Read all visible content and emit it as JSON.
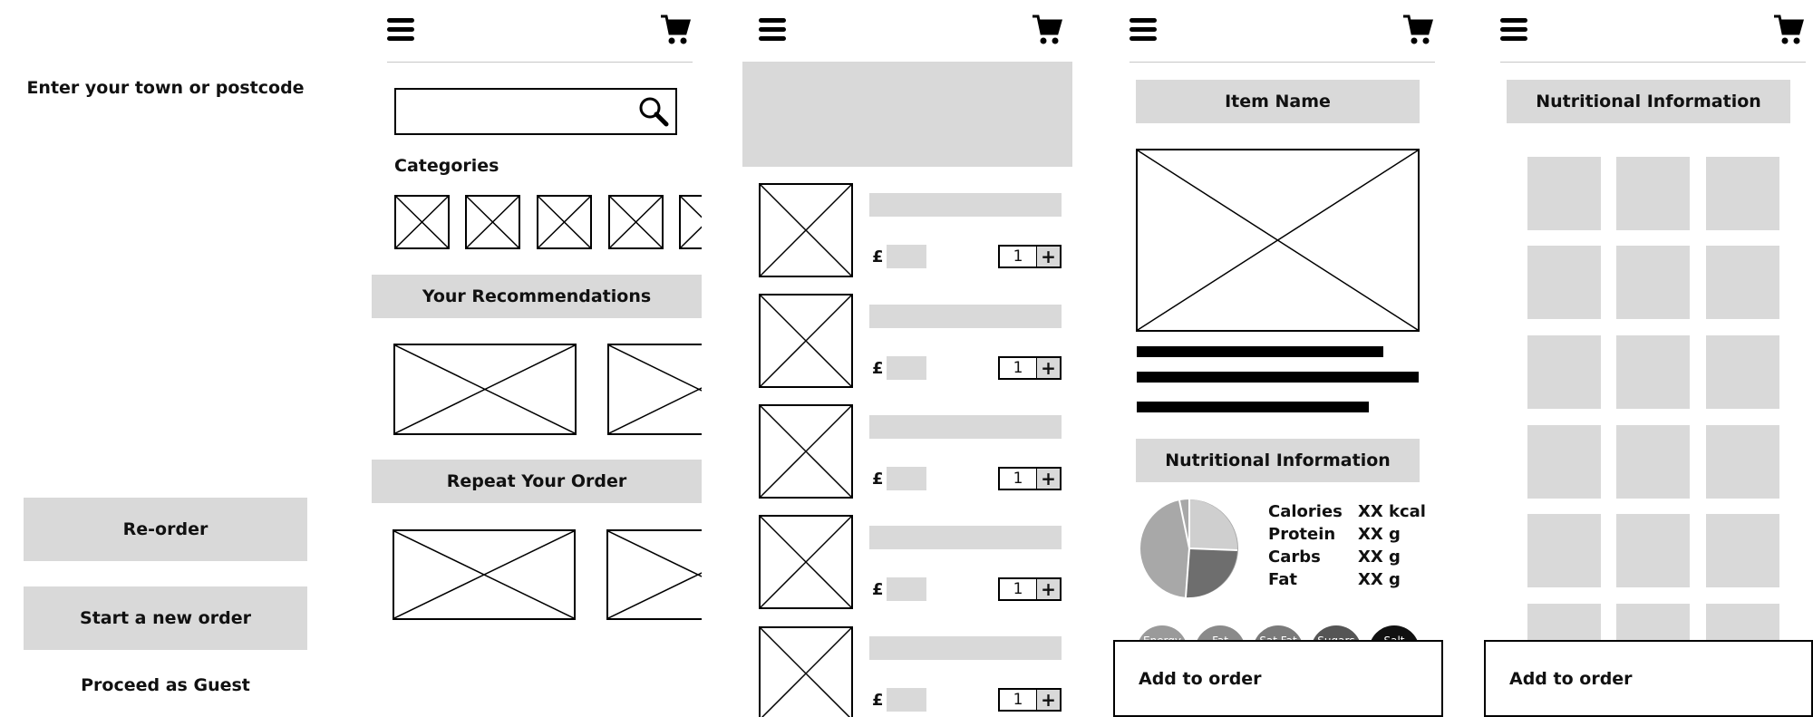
{
  "screen1": {
    "prompt": "Enter your town or postcode",
    "reorder_label": "Re-order",
    "new_order_label": "Start a new order",
    "guest_label": "Proceed as Guest"
  },
  "screen2": {
    "categories_label": "Categories",
    "recommendations_label": "Your Recommendations",
    "repeat_label": "Repeat Your Order"
  },
  "screen3": {
    "currency": "£",
    "items": [
      {
        "qty": "1"
      },
      {
        "qty": "1"
      },
      {
        "qty": "1"
      },
      {
        "qty": "1"
      },
      {
        "qty": "1"
      }
    ],
    "plus_label": "+"
  },
  "screen4": {
    "item_name": "Item Name",
    "nutrition_title": "Nutritional Information",
    "nutrition": [
      {
        "label": "Calories",
        "value": "XX kcal"
      },
      {
        "label": "Protein",
        "value": "XX g"
      },
      {
        "label": "Carbs",
        "value": "XX g"
      },
      {
        "label": "Fat",
        "value": "XX g"
      }
    ],
    "pills": [
      "Energy",
      "Fat",
      "Sat Fat",
      "Sugars",
      "Salt"
    ],
    "add_label": "Add to order"
  },
  "screen5": {
    "nutrition_title": "Nutritional Information",
    "add_label": "Add to order"
  },
  "colors": {
    "placeholder_gray": "#d9d9d9",
    "pie_light": "#cfcfcf",
    "pie_mid": "#a8a8a8",
    "pie_dark": "#6e6e6e"
  }
}
